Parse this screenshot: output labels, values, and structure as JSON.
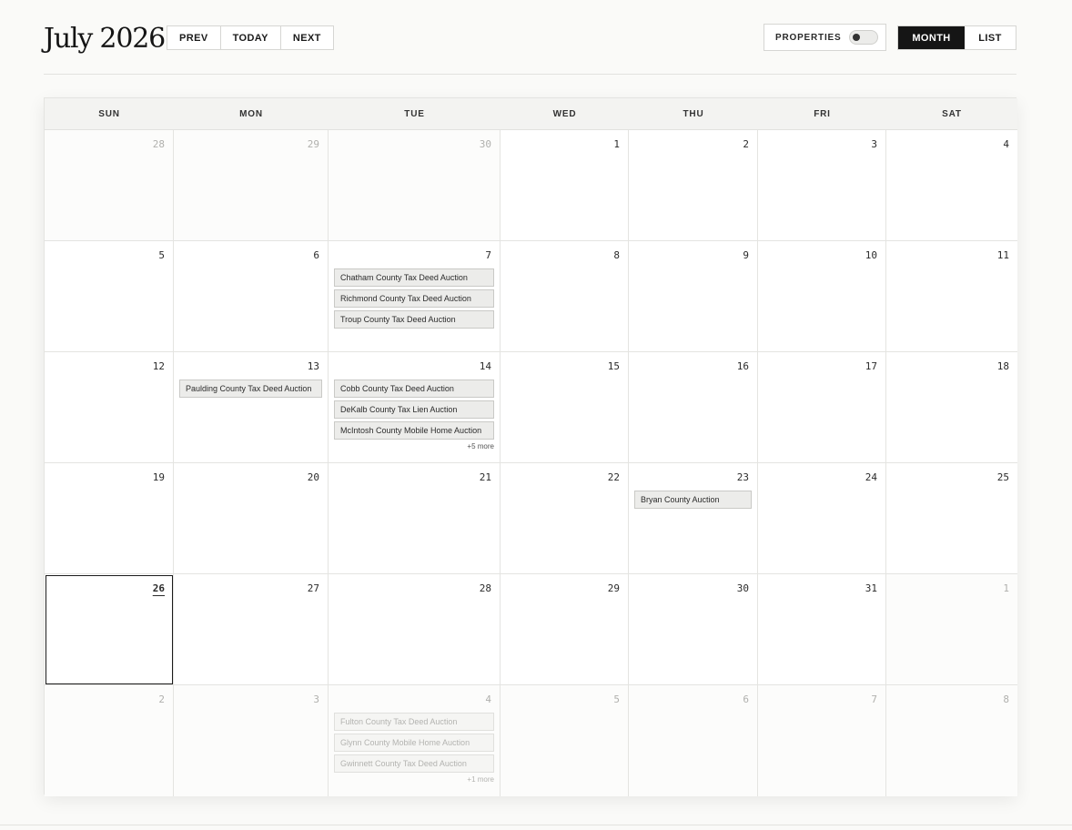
{
  "header": {
    "title": "July 2026",
    "nav": {
      "prev": "PREV",
      "today": "TODAY",
      "next": "NEXT"
    },
    "properties_label": "PROPERTIES",
    "properties_on": false,
    "views": {
      "month": "MONTH",
      "list": "LIST"
    },
    "active_view": "MONTH"
  },
  "weekdays": [
    "SUN",
    "MON",
    "TUE",
    "WED",
    "THU",
    "FRI",
    "SAT"
  ],
  "weeks": [
    [
      {
        "day": "28",
        "other": true,
        "events": [],
        "more": ""
      },
      {
        "day": "29",
        "other": true,
        "events": [],
        "more": ""
      },
      {
        "day": "30",
        "other": true,
        "events": [],
        "more": ""
      },
      {
        "day": "1",
        "other": false,
        "events": [],
        "more": ""
      },
      {
        "day": "2",
        "other": false,
        "events": [],
        "more": ""
      },
      {
        "day": "3",
        "other": false,
        "events": [],
        "more": ""
      },
      {
        "day": "4",
        "other": false,
        "events": [],
        "more": ""
      }
    ],
    [
      {
        "day": "5",
        "other": false,
        "events": [],
        "more": ""
      },
      {
        "day": "6",
        "other": false,
        "events": [],
        "more": ""
      },
      {
        "day": "7",
        "other": false,
        "events": [
          "Chatham County Tax Deed Auction",
          "Richmond County Tax Deed Auction",
          "Troup County Tax Deed Auction"
        ],
        "more": ""
      },
      {
        "day": "8",
        "other": false,
        "events": [],
        "more": ""
      },
      {
        "day": "9",
        "other": false,
        "events": [],
        "more": ""
      },
      {
        "day": "10",
        "other": false,
        "events": [],
        "more": ""
      },
      {
        "day": "11",
        "other": false,
        "events": [],
        "more": ""
      }
    ],
    [
      {
        "day": "12",
        "other": false,
        "events": [],
        "more": ""
      },
      {
        "day": "13",
        "other": false,
        "events": [
          "Paulding County Tax Deed Auction"
        ],
        "more": ""
      },
      {
        "day": "14",
        "other": false,
        "events": [
          "Cobb County Tax Deed Auction",
          "DeKalb County Tax Lien Auction",
          "McIntosh County Mobile Home Auction"
        ],
        "more": "+5 more"
      },
      {
        "day": "15",
        "other": false,
        "events": [],
        "more": ""
      },
      {
        "day": "16",
        "other": false,
        "events": [],
        "more": ""
      },
      {
        "day": "17",
        "other": false,
        "events": [],
        "more": ""
      },
      {
        "day": "18",
        "other": false,
        "events": [],
        "more": ""
      }
    ],
    [
      {
        "day": "19",
        "other": false,
        "events": [],
        "more": ""
      },
      {
        "day": "20",
        "other": false,
        "events": [],
        "more": ""
      },
      {
        "day": "21",
        "other": false,
        "events": [],
        "more": ""
      },
      {
        "day": "22",
        "other": false,
        "events": [],
        "more": ""
      },
      {
        "day": "23",
        "other": false,
        "events": [
          "Bryan County Auction"
        ],
        "more": ""
      },
      {
        "day": "24",
        "other": false,
        "events": [],
        "more": ""
      },
      {
        "day": "25",
        "other": false,
        "events": [],
        "more": ""
      }
    ],
    [
      {
        "day": "26",
        "other": false,
        "today": true,
        "events": [],
        "more": ""
      },
      {
        "day": "27",
        "other": false,
        "events": [],
        "more": ""
      },
      {
        "day": "28",
        "other": false,
        "events": [],
        "more": ""
      },
      {
        "day": "29",
        "other": false,
        "events": [],
        "more": ""
      },
      {
        "day": "30",
        "other": false,
        "events": [],
        "more": ""
      },
      {
        "day": "31",
        "other": false,
        "events": [],
        "more": ""
      },
      {
        "day": "1",
        "other": true,
        "events": [],
        "more": ""
      }
    ],
    [
      {
        "day": "2",
        "other": true,
        "events": [],
        "more": ""
      },
      {
        "day": "3",
        "other": true,
        "events": [],
        "more": ""
      },
      {
        "day": "4",
        "other": true,
        "events": [
          "Fulton County Tax Deed Auction",
          "Glynn County Mobile Home Auction",
          "Gwinnett County Tax Deed Auction"
        ],
        "more": "+1 more"
      },
      {
        "day": "5",
        "other": true,
        "events": [],
        "more": ""
      },
      {
        "day": "6",
        "other": true,
        "events": [],
        "more": ""
      },
      {
        "day": "7",
        "other": true,
        "events": [],
        "more": ""
      },
      {
        "day": "8",
        "other": true,
        "events": [],
        "more": ""
      }
    ]
  ]
}
